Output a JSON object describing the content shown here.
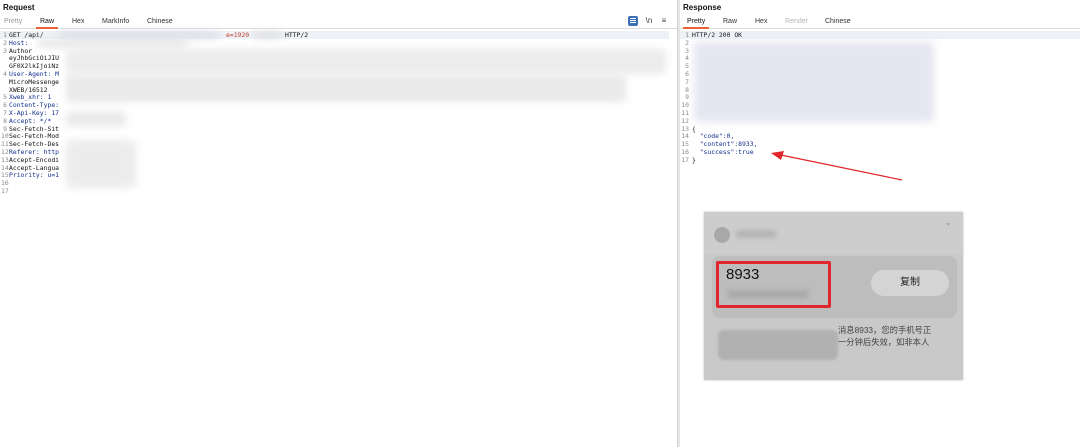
{
  "request": {
    "title": "Request",
    "tabs": [
      "Pretty",
      "Raw",
      "Hex",
      "MarkInfo",
      "Chinese"
    ],
    "active_tab": "Raw",
    "tool_icons": [
      "message-format-icon",
      "newline-toggle-icon",
      "menu-icon"
    ],
    "tool_glyphs": {
      "newline": "\\n",
      "menu": "≡"
    },
    "lines": [
      {
        "n": "1",
        "a": "GET /api/",
        "b": "e=1920",
        "c": "HTTP/2"
      },
      {
        "n": "2",
        "a": "Host:"
      },
      {
        "n": "3",
        "a": "Author"
      },
      {
        "n": "",
        "a": "eyJhbGciOiJIU"
      },
      {
        "n": "",
        "a": "GF0X2lkIjoiNz"
      },
      {
        "n": "4",
        "a": "User-Agent: M"
      },
      {
        "n": "",
        "a": "MicroMessenge"
      },
      {
        "n": "",
        "a": "XWEB/16512"
      },
      {
        "n": "5",
        "a": "Xweb_xhr: 1"
      },
      {
        "n": "6",
        "a": "Content-Type:"
      },
      {
        "n": "7",
        "a": "X-Api-Key: 17"
      },
      {
        "n": "8",
        "a": "Accept: */*"
      },
      {
        "n": "9",
        "a": "Sec-Fetch-Sit"
      },
      {
        "n": "10",
        "a": "Sec-Fetch-Mod"
      },
      {
        "n": "11",
        "a": "Sec-Fetch-Des"
      },
      {
        "n": "12",
        "a": "Referer: http"
      },
      {
        "n": "13",
        "a": "Accept-Encodi"
      },
      {
        "n": "14",
        "a": "Accept-Langua"
      },
      {
        "n": "15",
        "a": "Priority: u=1"
      },
      {
        "n": "16",
        "a": ""
      },
      {
        "n": "17",
        "a": ""
      }
    ]
  },
  "response": {
    "title": "Response",
    "tabs": [
      "Pretty",
      "Raw",
      "Hex",
      "Render",
      "Chinese"
    ],
    "active_tab": "Pretty",
    "lines": [
      {
        "n": "1",
        "t": "HTTP/2 200 OK"
      },
      {
        "n": "2",
        "t": ""
      },
      {
        "n": "3",
        "t": ""
      },
      {
        "n": "4",
        "t": ""
      },
      {
        "n": "5",
        "t": ""
      },
      {
        "n": "6",
        "t": ""
      },
      {
        "n": "7",
        "t": ""
      },
      {
        "n": "8",
        "t": ""
      },
      {
        "n": "9",
        "t": ""
      },
      {
        "n": "10",
        "t": ""
      },
      {
        "n": "11",
        "t": ""
      },
      {
        "n": "12",
        "t": ""
      },
      {
        "n": "13",
        "t": "{"
      },
      {
        "n": "14",
        "t": "  \"code\":0,"
      },
      {
        "n": "15",
        "t": "  \"content\":8933,"
      },
      {
        "n": "16",
        "t": "  \"success\":true"
      },
      {
        "n": "17",
        "t": "}"
      }
    ]
  },
  "sms": {
    "code": "8933",
    "copy_label": "复制",
    "message_line1": "消息8933，您的手机号正",
    "message_line2": "一分钟后失效，如非本人"
  },
  "colors": {
    "accent": "#e8623a",
    "header_key": "#12308c",
    "highlight_box": "#e0262c",
    "arrow": "#e0262c"
  }
}
